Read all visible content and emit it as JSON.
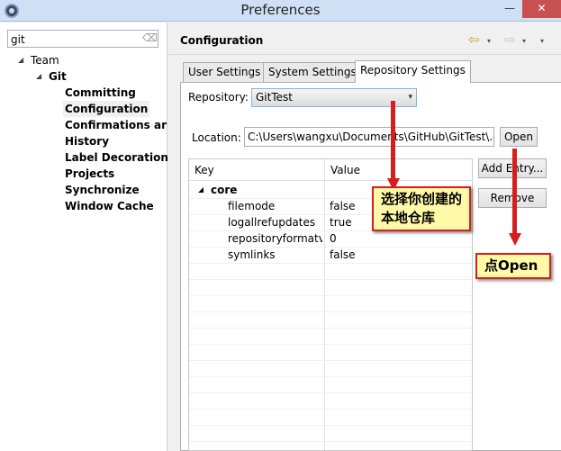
{
  "window": {
    "title": "Preferences",
    "minimize": "—",
    "close": "✕"
  },
  "filter": {
    "value": "git",
    "clear": "⌫"
  },
  "tree": {
    "team": "Team",
    "git": "Git",
    "children": [
      "Committing",
      "Configuration",
      "Confirmations ar",
      "History",
      "Label Decoration",
      "Projects",
      "Synchronize",
      "Window Cache"
    ]
  },
  "page": {
    "title": "Configuration",
    "back": "⇦",
    "forward": "⇨",
    "dropdown": "▾"
  },
  "tabs": [
    "User Settings",
    "System Settings",
    "Repository Settings"
  ],
  "repository": {
    "label": "Repository:",
    "value": "GitTest",
    "arrow": "▾"
  },
  "location": {
    "label": "Location:",
    "value": "C:\\Users\\wangxu\\Documents\\GitHub\\GitTest\\.g"
  },
  "buttons": {
    "open": "Open",
    "add_entry": "Add Entry...",
    "remove": "Remove"
  },
  "table": {
    "headers": [
      "Key",
      "Value"
    ],
    "group": "core",
    "rows": [
      {
        "key": "filemode",
        "value": "false"
      },
      {
        "key": "logallrefupdates",
        "value": "true"
      },
      {
        "key": "repositoryformatversion",
        "value": "0"
      },
      {
        "key": "symlinks",
        "value": "false"
      }
    ]
  },
  "annotations": {
    "repo_note": "选择你创建的本地仓库",
    "open_note": "点Open"
  },
  "colors": {
    "annotation_border": "#d71e1e",
    "annotation_fill": "#fff9a8"
  }
}
